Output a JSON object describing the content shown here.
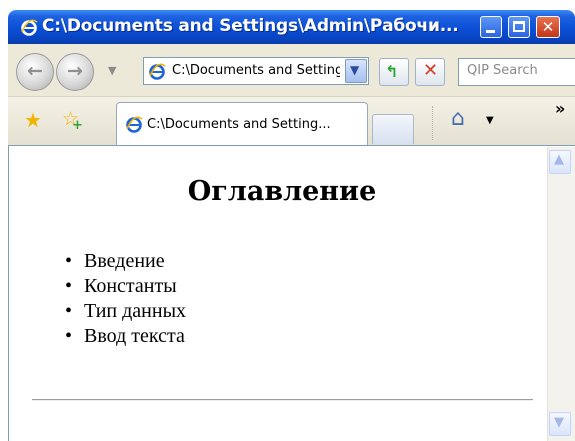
{
  "window": {
    "title": "C:\\Documents and Settings\\Admin\\Рабочи...",
    "icon": "ie-logo-icon",
    "buttons": {
      "minimize": "minimize-icon",
      "maximize": "maximize-icon",
      "close": "✕"
    }
  },
  "toolbar": {
    "back_glyph": "←",
    "forward_glyph": "→",
    "nav_dropdown_glyph": "▼",
    "address": "C:\\Documents and Settings\\Admin\\Рабочий стол",
    "address_dropdown_glyph": "▼",
    "go_glyph": "↰",
    "stop_glyph": "✕",
    "search_placeholder": "QIP Search"
  },
  "tabs_row": {
    "favorites_glyph": "★",
    "add_favorite_glyph": "☆",
    "add_favorite_plus": "+",
    "active_tab_label": "C:\\Documents and Setting...",
    "home_glyph": "⌂",
    "home_dropdown_glyph": "▼",
    "more_glyph": "»"
  },
  "page": {
    "heading": "Оглавление",
    "toc_items": [
      "Введение",
      "Константы",
      "Тип данных",
      "Ввод текста"
    ]
  },
  "scrollbar": {
    "up_glyph": "▲",
    "down_glyph": "▼"
  },
  "colors": {
    "titlebar": "#0a4fd6",
    "close_button": "#c2361b",
    "chrome": "#ece9d8",
    "border": "#7f9db9"
  }
}
